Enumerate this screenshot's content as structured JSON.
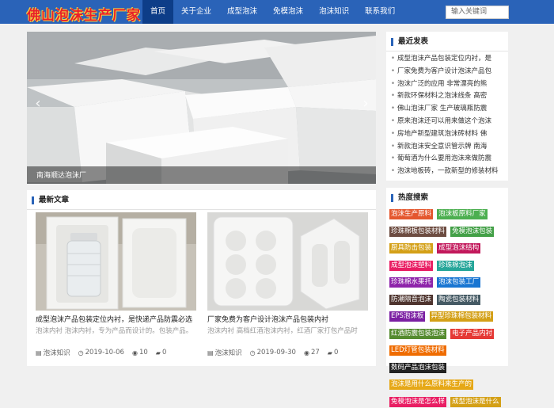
{
  "header": {
    "logo": "佛山泡沫生产厂家",
    "nav": [
      "首页",
      "关于企业",
      "成型泡沫",
      "免模泡沫",
      "泡沫知识",
      "联系我们"
    ],
    "active_index": 0,
    "search_placeholder": "输入关键词"
  },
  "slider": {
    "caption": "南海顺达泡沫厂",
    "prev_icon": "chevron-left-icon",
    "next_icon": "chevron-right-icon"
  },
  "latest": {
    "title": "最新文章",
    "cards": [
      {
        "title": "成型泡沫产品包装定位内衬，是快递产品防震必选",
        "desc": "泡沫内衬 泡沫内衬，专为产品而设计的。包装产品。",
        "category": "泡沫知识",
        "date": "2019-10-06",
        "views": "10",
        "comments": "0"
      },
      {
        "title": "厂家免费为客户设计泡沫产品包装内衬",
        "desc": "泡沫内衬 高档红酒泡沫内衬，红酒厂家打包产品时",
        "category": "泡沫知识",
        "date": "2019-09-30",
        "views": "27",
        "comments": "0"
      }
    ]
  },
  "recent": {
    "title": "最近发表",
    "items": [
      "成型泡沫产品包装定位内衬，是",
      "厂家免费为客户设计泡沫产品包",
      "泡沫广泛的应用 非常漂亮的熊",
      "新款环保材料之泡沫线条 高密",
      "佛山泡沫厂家 生产玻璃瓶防震",
      "原来泡沫还可以用来做这个泡沫",
      "房地产新型建筑泡沫砖材料 佛",
      "新款泡沫安全意识管示牌 南海",
      "葡萄酒为什么要用泡沫来做防震",
      "泡沫地板砖，一款新型的修装材料"
    ]
  },
  "hot_tags": {
    "title": "热度搜索",
    "tags": [
      {
        "label": "泡沫生产原料",
        "color": "#e4572e"
      },
      {
        "label": "泡沫板原料厂家",
        "color": "#4caf50"
      },
      {
        "label": "珍珠棉板包装材料",
        "color": "#6d4c41"
      },
      {
        "label": "免模泡沫包装",
        "color": "#43a047"
      },
      {
        "label": "厨具防击包装",
        "color": "#d4a017"
      },
      {
        "label": "成型泡沫结构",
        "color": "#c2185b"
      },
      {
        "label": "成型泡沫塑料",
        "color": "#e91e63"
      },
      {
        "label": "珍珠棉泡沫",
        "color": "#26a69a"
      },
      {
        "label": "珍珠棉水果托",
        "color": "#8e24aa"
      },
      {
        "label": "泡沫包装工厂",
        "color": "#1976d2"
      },
      {
        "label": "防潮隔音泡沫",
        "color": "#4e342e"
      },
      {
        "label": "陶瓷包装材料",
        "color": "#455a64"
      },
      {
        "label": "EPS泡沫板",
        "color": "#7b1fa2"
      },
      {
        "label": "异型珍珠棉包装材料",
        "color": "#d4a017"
      },
      {
        "label": "红酒防震包装泡沫",
        "color": "#558b2f"
      },
      {
        "label": "电子产品内衬",
        "color": "#e53935"
      },
      {
        "label": "LED灯管包装材料",
        "color": "#ef6c00"
      },
      {
        "label": "数码产品泡沫包装",
        "color": "#212121"
      },
      {
        "label": "泡沫是用什么原料来生产的",
        "color": "#e6a817"
      },
      {
        "label": "免模泡沫是怎么样",
        "color": "#e91e63"
      },
      {
        "label": "成型泡沫是什么",
        "color": "#d4a017"
      }
    ]
  }
}
